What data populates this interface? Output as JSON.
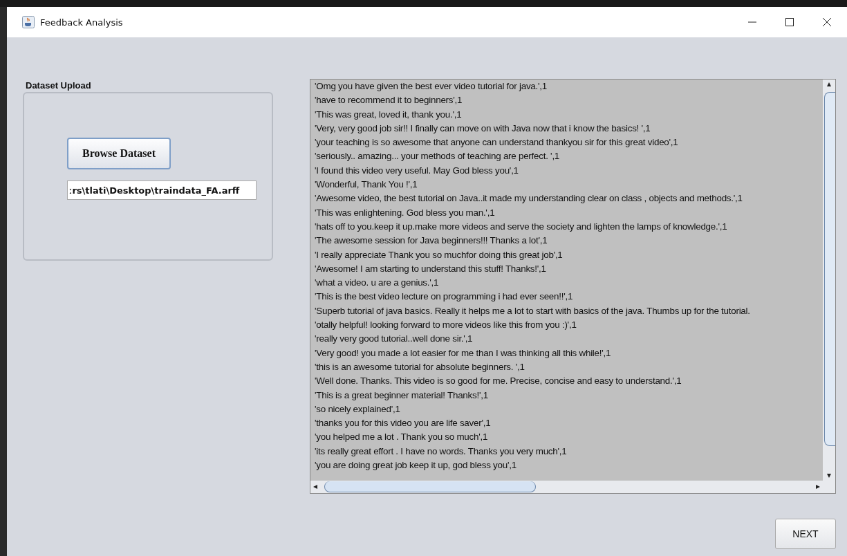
{
  "window": {
    "title": "Feedback Analysis"
  },
  "upload": {
    "title": "Dataset Upload",
    "browse_button": "Browse Dataset",
    "path": "ːrs\\tlati\\Desktop\\traindata_FA.arff"
  },
  "output": {
    "lines": [
      "'Omg you have given the best ever video tutorial for java.',1",
      "'have to recommend it to beginners',1",
      "'This was great, loved it, thank you.',1",
      "'Very, very good job sir!! I finally can move on with Java now that i know the basics! ',1",
      "'your teaching is so awesome that anyone can understand thankyou sir for this great video',1",
      "'seriously.. amazing... your methods of teaching are perfect. ',1",
      "'I found this video very useful. May God bless you',1",
      "'Wonderful, Thank You !',1",
      "'Awesome video, the best tutorial on Java..it made my understanding clear on class , objects and methods.',1",
      "'This was enlightening. God bless you man.',1",
      "'hats off to you.keep it up.make more videos and serve the society and lighten the lamps of knowledge.',1",
      "'The awesome session for Java beginners!!! Thanks a lot',1",
      "'I really appreciate Thank you so muchfor doing this great job',1",
      "'Awesome! I am starting to understand this stuff! Thanks!',1",
      "'what a video. u are a genius.',1",
      "'This is the best video lecture on programming i had ever seen!!',1",
      "'Superb tutorial of java basics. Really it helps me a lot to start with basics of the java. Thumbs up for the tutorial.",
      "'otally helpful! looking forward to more videos like this from you :)',1",
      "'really very good tutorial..well done sir.',1",
      "'Very good! you made a lot easier for me than I was thinking all this while!',1",
      "'this is an awesome tutorial for absolute beginners. ',1",
      "'Well done. Thanks. This video is so good for me. Precise, concise and easy to understand.',1",
      "'This is a great beginner material! Thanks!',1",
      "'so nicely explained',1",
      "'thanks you for this video you are life saver',1",
      "'you helped me a lot . Thank you so much',1",
      "'its really great effort . I have no words. Thanks you very much',1",
      "'you are doing great job keep it up, god bless you',1"
    ]
  },
  "next_button": "NEXT"
}
